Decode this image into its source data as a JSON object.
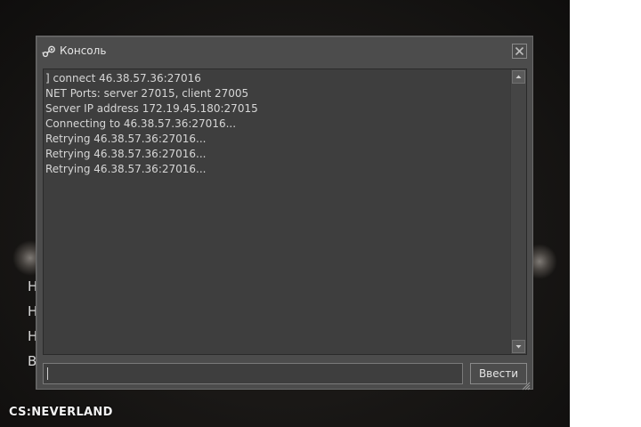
{
  "background": {
    "menu_letters": [
      "Н",
      "Н",
      "Н",
      "В"
    ],
    "logo_text": "CS:NEVERLAND"
  },
  "console": {
    "title": "Консоль",
    "title_icon": "steam-icon",
    "close_icon": "close-icon",
    "log_lines": [
      "] connect 46.38.57.36:27016",
      "NET Ports:  server 27015, client 27005",
      "Server IP address 172.19.45.180:27015",
      "Connecting to 46.38.57.36:27016...",
      "Retrying 46.38.57.36:27016...",
      "Retrying 46.38.57.36:27016...",
      "Retrying 46.38.57.36:27016..."
    ],
    "input_value": "",
    "input_placeholder": "",
    "submit_label": "Ввести",
    "scroll_up_icon": "arrow-up-icon",
    "scroll_down_icon": "arrow-down-icon",
    "resize_icon": "resize-grip-icon"
  },
  "colors": {
    "window_bg": "#4c4c4c",
    "output_bg": "#3e3e3e",
    "text": "#d6d6d6"
  }
}
